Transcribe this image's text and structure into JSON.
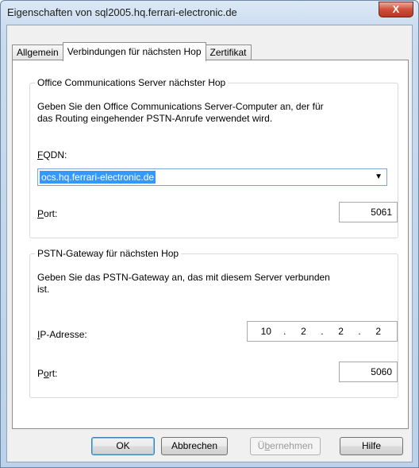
{
  "window": {
    "title": "Eigenschaften von sql2005.hq.ferrari-electronic.de",
    "close_label": "X"
  },
  "tabs": [
    {
      "label": "Allgemein",
      "active": false
    },
    {
      "label": "Verbindungen für nächsten Hop",
      "active": true
    },
    {
      "label": "Zertifikat",
      "active": false
    }
  ],
  "ocs_group": {
    "legend": "Office Communications Server nächster Hop",
    "description_line1": "Geben Sie den Office Communications Server-Computer an, der für",
    "description_line2": "das Routing eingehender PSTN-Anrufe verwendet wird.",
    "fqdn_label_u": "F",
    "fqdn_label_rest": "QDN:",
    "fqdn_value": "ocs.hq.ferrari-electronic.de",
    "port_label_u": "P",
    "port_label_rest": "ort:",
    "port_value": "5061"
  },
  "pstn_group": {
    "legend": "PSTN-Gateway für nächsten Hop",
    "description_line1": "Geben Sie das PSTN-Gateway an, das mit diesem Server verbunden",
    "description_line2": "ist.",
    "ip_label_u": "I",
    "ip_label_rest": "P-Adresse:",
    "ip_octets": [
      "10",
      "2",
      "2",
      "2"
    ],
    "ip_separator": ".",
    "port_label_pre": "P",
    "port_label_u": "o",
    "port_label_rest": "rt:",
    "port_value": "5060"
  },
  "buttons": {
    "ok": "OK",
    "cancel": "Abbrechen",
    "apply_pre": "Ü",
    "apply_u": "b",
    "apply_rest": "ernehmen",
    "help": "Hilfe"
  }
}
